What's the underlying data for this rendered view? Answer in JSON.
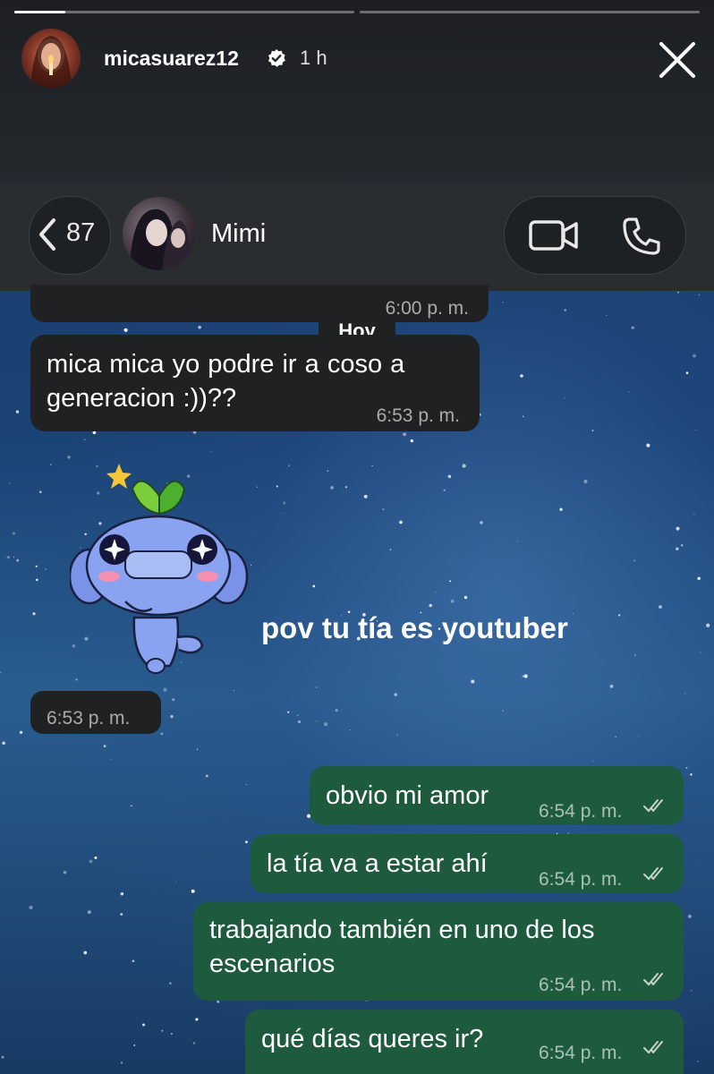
{
  "story": {
    "username": "micasuarez12",
    "time_ago": "1 h",
    "progress_segments": [
      0.15,
      0
    ]
  },
  "chat": {
    "back_count": "87",
    "contact_name": "Mimi"
  },
  "messages": {
    "prev_time": "6:00 p. m.",
    "date_badge": "Hoy",
    "in1_text": "mica mica yo podre ir a coso a generacion :))??",
    "in1_time": "6:53 p. m.",
    "sticker_time": "6:53 p. m.",
    "out": [
      {
        "text": "obvio mi amor",
        "time": "6:54 p. m."
      },
      {
        "text": "la tía va a estar ahí",
        "time": "6:54 p. m."
      },
      {
        "text": "trabajando también en uno de los escenarios",
        "time": "6:54 p. m."
      },
      {
        "text": "qué días queres ir?",
        "time": "6:54 p. m."
      }
    ]
  },
  "overlay": {
    "caption": "pov tu tía es youtuber"
  },
  "colors": {
    "outgoing_bubble": "#1e5b3e",
    "incoming_bubble": "#1f2123",
    "header": "#2a2d30"
  }
}
